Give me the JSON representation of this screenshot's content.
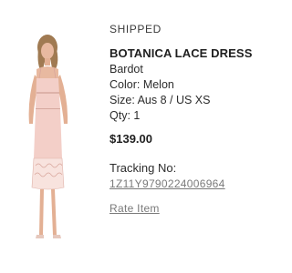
{
  "order_item": {
    "status": "SHIPPED",
    "product_name": "BOTANICA LACE DRESS",
    "brand": "Bardot",
    "color_line": "Color: Melon",
    "size_line": "Size: Aus 8 / US XS",
    "qty_line": "Qty: 1",
    "price": "$139.00",
    "tracking_label": "Tracking No:",
    "tracking_number": "1Z11Y9790224006964",
    "rate_label": "Rate Item"
  },
  "colors": {
    "dress": "#f3cfc8",
    "skin": "#e8b9a0",
    "hair": "#a07a52"
  }
}
